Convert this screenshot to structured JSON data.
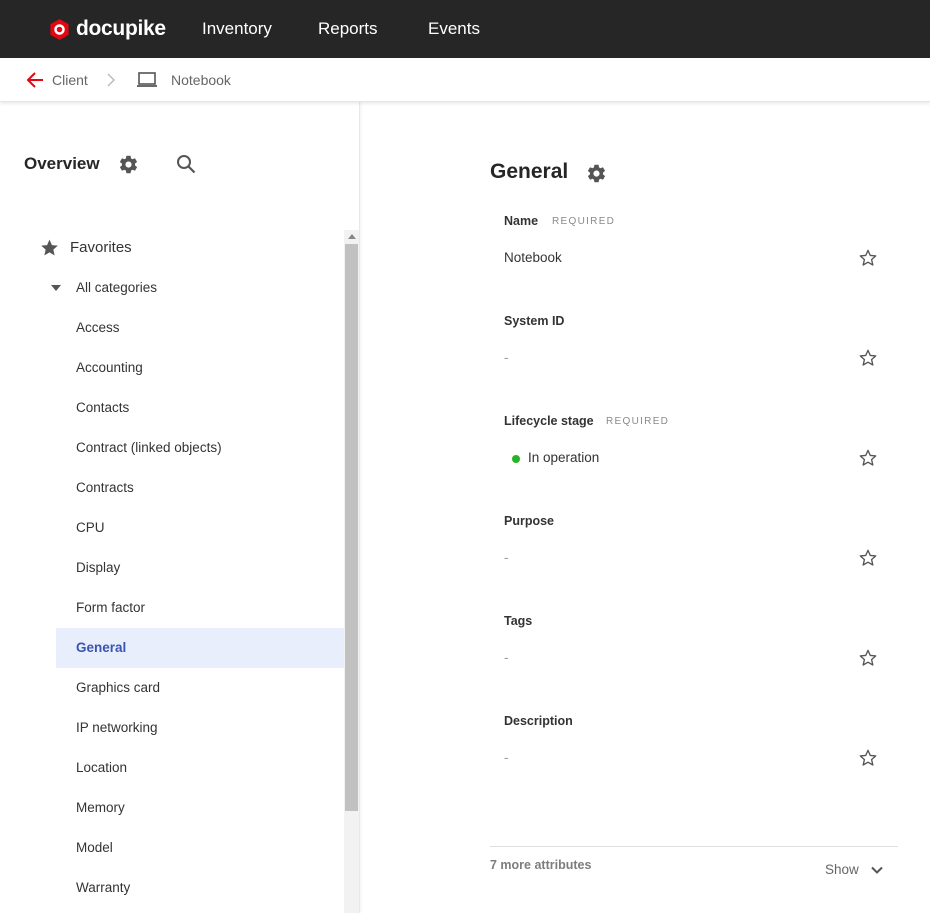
{
  "app": {
    "brand": "docupike",
    "brand_color": "#e30613"
  },
  "topnav": [
    "Inventory",
    "Reports",
    "Events"
  ],
  "breadcrumb": {
    "parent": "Client",
    "current": "Notebook",
    "device_icon": "laptop-icon"
  },
  "sidebar": {
    "title": "Overview",
    "favorites": "Favorites",
    "all_categories": "All categories",
    "categories": [
      "Access",
      "Accounting",
      "Contacts",
      "Contract (linked objects)",
      "Contracts",
      "CPU",
      "Display",
      "Form factor",
      "General",
      "Graphics card",
      "IP networking",
      "Location",
      "Memory",
      "Model",
      "Warranty"
    ],
    "active_category": "General"
  },
  "section": {
    "title": "General",
    "required_label": "REQUIRED",
    "attributes": [
      {
        "label": "Name",
        "required": true,
        "value": "Notebook"
      },
      {
        "label": "System ID",
        "required": false,
        "value": "-"
      },
      {
        "label": "Lifecycle stage",
        "required": true,
        "value": "In operation",
        "status_color": "#25b425"
      },
      {
        "label": "Purpose",
        "required": false,
        "value": "-"
      },
      {
        "label": "Tags",
        "required": false,
        "value": "-"
      },
      {
        "label": "Description",
        "required": false,
        "value": "-"
      }
    ],
    "more_attributes": "7 more attributes",
    "show_label": "Show"
  }
}
